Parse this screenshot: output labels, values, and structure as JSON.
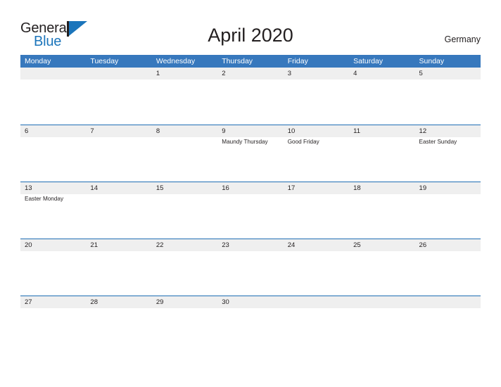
{
  "brand": {
    "name_part1": "General",
    "name_part2": "Blue",
    "mark": "flag-triangle-icon",
    "color_dark": "#231f20",
    "color_blue": "#1b75bb"
  },
  "header": {
    "title": "April 2020",
    "country": "Germany"
  },
  "theme": {
    "header_blue": "#3778bd",
    "divider_blue": "#1f6eb4",
    "band_gray": "#efefef",
    "text": "#231f20",
    "page_background": "#ffffff"
  },
  "calendar": {
    "month": "April",
    "year": "2020",
    "day_headers": [
      "Monday",
      "Tuesday",
      "Wednesday",
      "Thursday",
      "Friday",
      "Saturday",
      "Sunday"
    ],
    "weeks": [
      [
        {
          "date": "",
          "event": ""
        },
        {
          "date": "",
          "event": ""
        },
        {
          "date": "1",
          "event": ""
        },
        {
          "date": "2",
          "event": ""
        },
        {
          "date": "3",
          "event": ""
        },
        {
          "date": "4",
          "event": ""
        },
        {
          "date": "5",
          "event": ""
        }
      ],
      [
        {
          "date": "6",
          "event": ""
        },
        {
          "date": "7",
          "event": ""
        },
        {
          "date": "8",
          "event": ""
        },
        {
          "date": "9",
          "event": "Maundy Thursday"
        },
        {
          "date": "10",
          "event": "Good Friday"
        },
        {
          "date": "11",
          "event": ""
        },
        {
          "date": "12",
          "event": "Easter Sunday"
        }
      ],
      [
        {
          "date": "13",
          "event": "Easter Monday"
        },
        {
          "date": "14",
          "event": ""
        },
        {
          "date": "15",
          "event": ""
        },
        {
          "date": "16",
          "event": ""
        },
        {
          "date": "17",
          "event": ""
        },
        {
          "date": "18",
          "event": ""
        },
        {
          "date": "19",
          "event": ""
        }
      ],
      [
        {
          "date": "20",
          "event": ""
        },
        {
          "date": "21",
          "event": ""
        },
        {
          "date": "22",
          "event": ""
        },
        {
          "date": "23",
          "event": ""
        },
        {
          "date": "24",
          "event": ""
        },
        {
          "date": "25",
          "event": ""
        },
        {
          "date": "26",
          "event": ""
        }
      ],
      [
        {
          "date": "27",
          "event": ""
        },
        {
          "date": "28",
          "event": ""
        },
        {
          "date": "29",
          "event": ""
        },
        {
          "date": "30",
          "event": ""
        },
        {
          "date": "",
          "event": ""
        },
        {
          "date": "",
          "event": ""
        },
        {
          "date": "",
          "event": ""
        }
      ]
    ]
  }
}
